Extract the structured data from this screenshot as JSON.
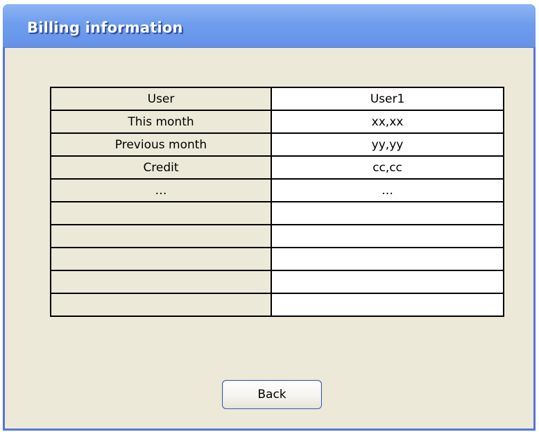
{
  "window": {
    "title": "Billing information"
  },
  "billing_table": {
    "rows": [
      {
        "label": "User",
        "value": "User1"
      },
      {
        "label": "This month",
        "value": "xx,xx"
      },
      {
        "label": "Previous month",
        "value": "yy,yy"
      },
      {
        "label": "Credit",
        "value": "cc,cc"
      },
      {
        "label": "…",
        "value": "…"
      },
      {
        "label": "",
        "value": ""
      },
      {
        "label": "",
        "value": ""
      },
      {
        "label": "",
        "value": ""
      },
      {
        "label": "",
        "value": ""
      },
      {
        "label": "",
        "value": ""
      }
    ]
  },
  "actions": {
    "back_label": "Back"
  },
  "colors": {
    "titlebar": "#6f9ded",
    "window_bg": "#ece9d8",
    "window_border": "#5874d6"
  }
}
